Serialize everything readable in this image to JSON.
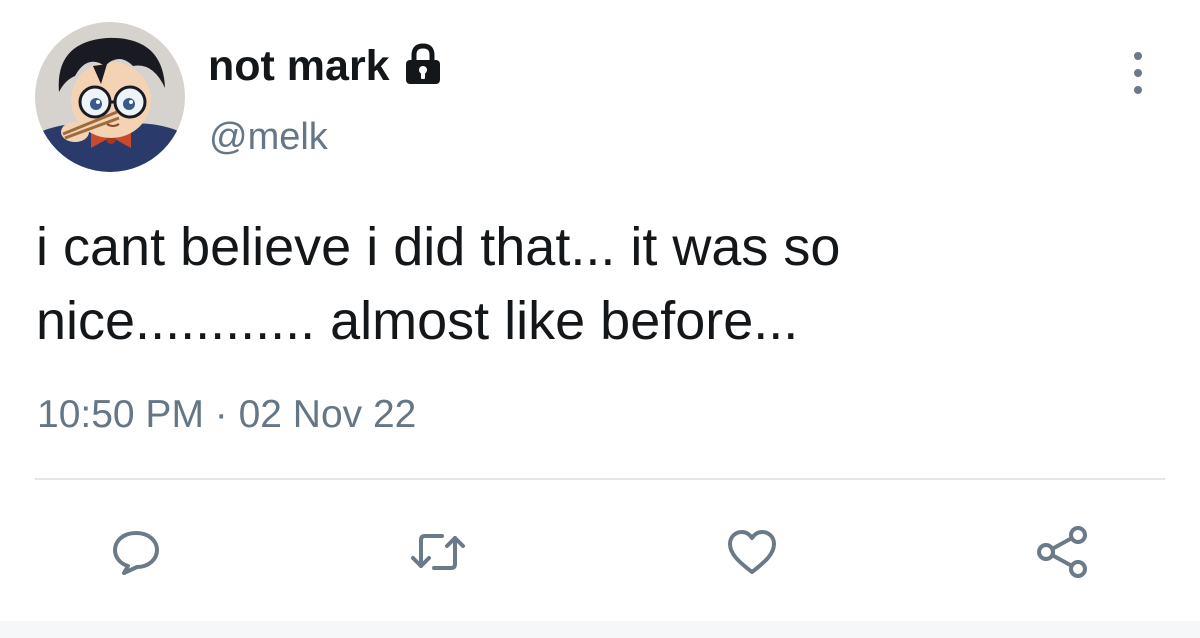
{
  "tweet": {
    "author": {
      "display_name": "not mark",
      "handle": "@melk",
      "avatar_icon": "anime-character-avatar",
      "protected_icon": "lock-icon"
    },
    "text_lines": [
      "i cant believe i did that... it was so",
      "nice............ almost like before..."
    ],
    "timestamp": "10:50 PM · 02 Nov 22"
  },
  "actions": {
    "reply_icon": "comment-bubble-icon",
    "retweet_icon": "retweet-icon",
    "like_icon": "heart-icon",
    "share_icon": "share-icon",
    "more_icon": "more-vertical-icon"
  },
  "colors": {
    "text_primary": "#14171a",
    "text_secondary": "#657786",
    "icon_gray": "#6b7a89",
    "divider": "#e3e7eb"
  }
}
